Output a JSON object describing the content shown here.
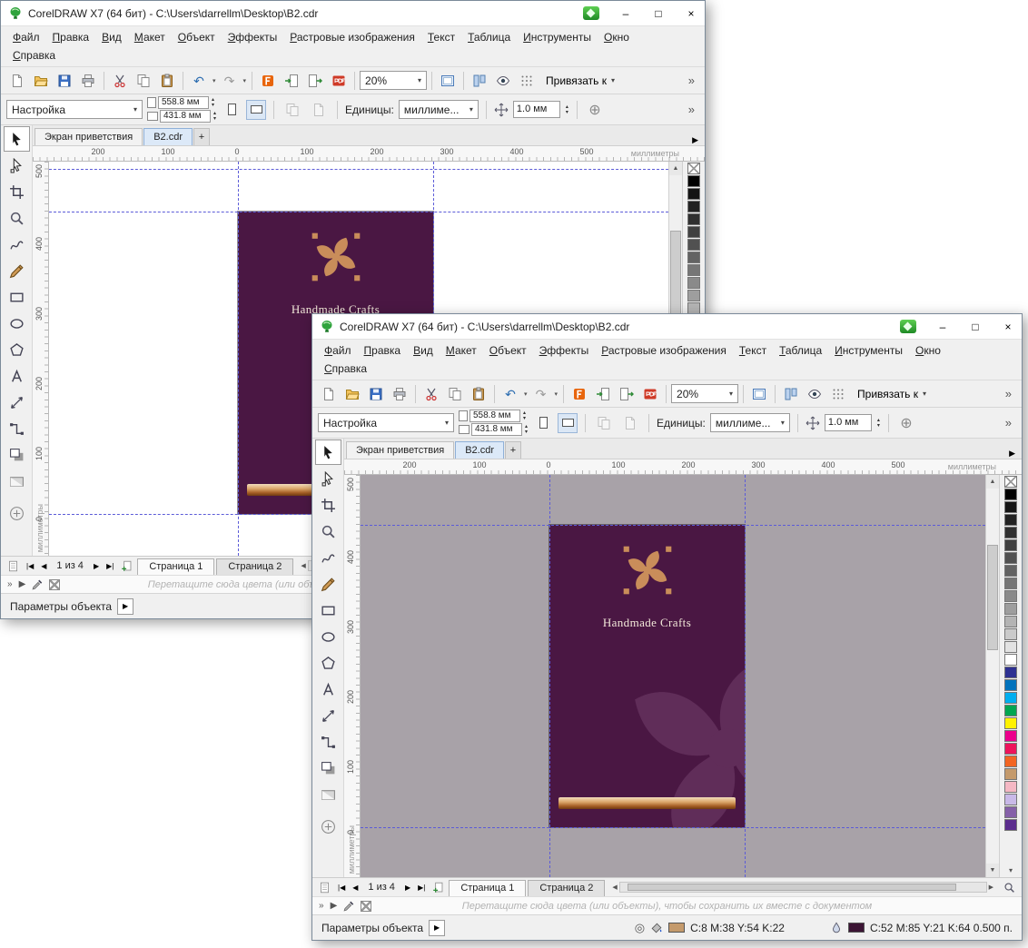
{
  "app": {
    "title": "CorelDRAW X7 (64 бит) - C:\\Users\\darrellm\\Desktop\\B2.cdr",
    "window_controls": {
      "minimize": "–",
      "maximize": "□",
      "close": "×"
    },
    "menus": [
      "Файл",
      "Правка",
      "Вид",
      "Макет",
      "Объект",
      "Эффекты",
      "Растровые изображения",
      "Текст",
      "Таблица",
      "Инструменты",
      "Окно",
      "Справка"
    ],
    "toolbar": {
      "zoom_value": "20%",
      "snap_label": "Привязать к"
    },
    "property_bar": {
      "preset": "Настройка",
      "page_width": "558.8 мм",
      "page_height": "431.8 мм",
      "units_label": "Единицы:",
      "units_value": "миллиме...",
      "nudge_value": "1.0 мм"
    },
    "doc_tabs": {
      "welcome": "Экран приветствия",
      "document": "B2.cdr",
      "add": "+"
    },
    "rulers": {
      "horizontal": [
        "200",
        "100",
        "0",
        "100",
        "200",
        "300",
        "400",
        "500"
      ],
      "vertical": [
        "500",
        "400",
        "300",
        "200",
        "100",
        "0"
      ],
      "units": "миллиметры"
    },
    "artwork": {
      "brand": "Handmade Crafts"
    },
    "page_bar": {
      "indicator": "1 из 4",
      "tabs": [
        "Страница 1",
        "Страница 2"
      ]
    },
    "hint": "Перетащите сюда цвета (или объекты), чтобы сохранить их вместе с документом",
    "status": {
      "object_props": "Параметры объекта",
      "fill_values": "C:8 M:38 Y:54 K:22",
      "outline_values": "C:52 M:85 Y:21 K:64  0.500 п.",
      "fill_color": "#c49a6c",
      "outline_color": "#3c1535"
    },
    "palette": [
      "none",
      "#000000",
      "#141414",
      "#222222",
      "#303030",
      "#404040",
      "#515151",
      "#636363",
      "#767676",
      "#8a8a8a",
      "#9e9e9e",
      "#b4b4b4",
      "#cacaca",
      "#e2e2e2",
      "#ffffff",
      "#2e3192",
      "#0072bc",
      "#00aeef",
      "#00a651",
      "#fff200",
      "#ec008c",
      "#ed145b",
      "#f26522",
      "#c49a6c",
      "#f5b8c4",
      "#c9b9e8",
      "#8560a8",
      "#5b2d8e"
    ],
    "colors": {
      "page_bg": "#4a1743",
      "canvas_back": "#ffffff",
      "canvas_front": "#a8a2a8",
      "accent": "#c98d5a",
      "watermark": "#7b4874",
      "guide": "#5b5bd8"
    },
    "icons": {
      "dropdown": "▾",
      "overflow": "»",
      "flyout": "▶",
      "undo": "↶",
      "redo": "↷",
      "first_page": "|◀",
      "prev_page": "◀",
      "next_page": "▶",
      "last_page": "▶|",
      "spin_up": "▴",
      "spin_down": "▾",
      "scroll_up": "▲",
      "scroll_down": "▼",
      "scroll_left": "◀",
      "scroll_right": "▶",
      "tab_scroll": "▶",
      "profile": "◎",
      "plus": "⊕"
    }
  }
}
